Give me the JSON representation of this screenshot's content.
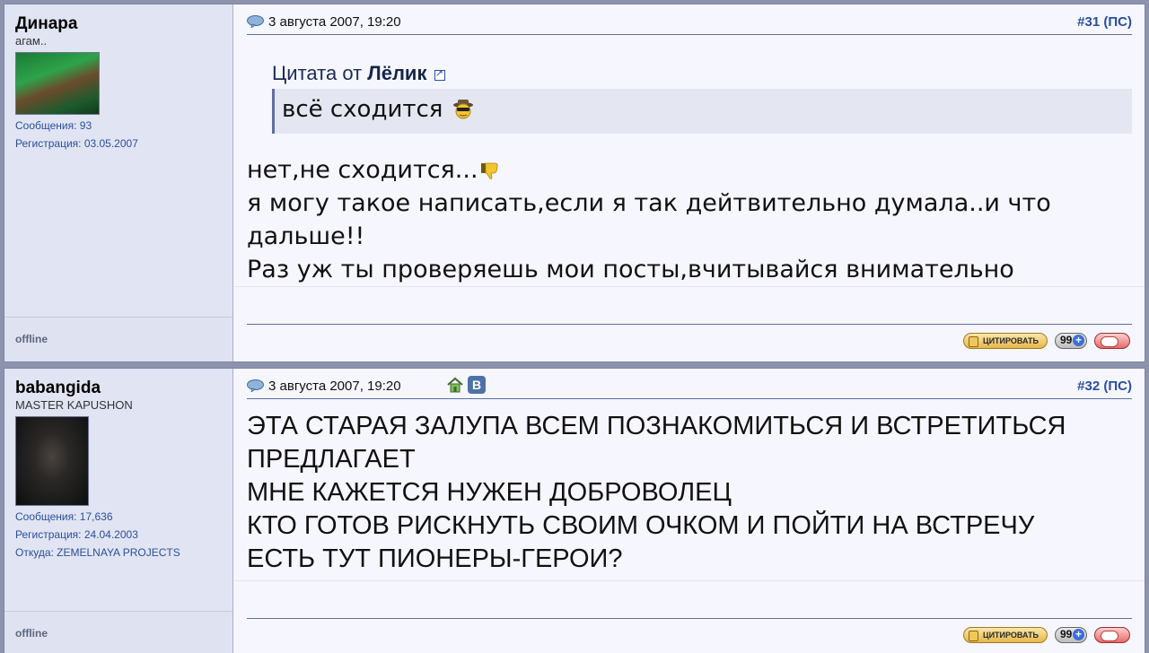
{
  "posts": [
    {
      "username": "Динара",
      "usertitle": "агам..",
      "stats": {
        "messages": "Сообщения: 93",
        "registration": "Регистрация: 03.05.2007"
      },
      "status": "offline",
      "date": "3 августа 2007, 19:20",
      "number": "#31",
      "pm": "ПС",
      "quote": {
        "prefix": "Цитата от",
        "author": "Лёлик",
        "text": "всё сходится"
      },
      "body": [
        "нет,не сходится...",
        "я могу такое написать,если я так дейтвительно думала..и что",
        "дальше!!",
        "Раз уж ты проверяешь мои посты,вчитывайся внимательно"
      ]
    },
    {
      "username": "babangida",
      "usertitle": "MASTER KAPUSHON",
      "stats": {
        "messages": "Сообщения: 17,636",
        "registration": "Регистрация: 24.04.2003",
        "location": "Откуда: ZEMELNAYA PROJECTS"
      },
      "status": "offline",
      "date": "3 августа 2007, 19:20",
      "number": "#32",
      "pm": "ПС",
      "vk_letter": "B",
      "body": [
        "ЭТА СТАРАЯ ЗАЛУПА ВСЕМ ПОЗНАКОМИТЬСЯ И ВСТРЕТИТЬСЯ",
        "ПРЕДЛАГАЕТ",
        "МНЕ КАЖЕТСЯ НУЖЕН ДОБРОВОЛЕЦ",
        "КТО ГОТОВ РИСКНУТЬ СВОИМ ОЧКОМ И ПОЙТИ НА ВСТРЕЧУ",
        "ЕСТЬ ТУТ ПИОНЕРЫ-ГЕРОИ?"
      ]
    }
  ],
  "buttons": {
    "quote": "ЦИТИРОВАТЬ",
    "multiquote": "99"
  }
}
